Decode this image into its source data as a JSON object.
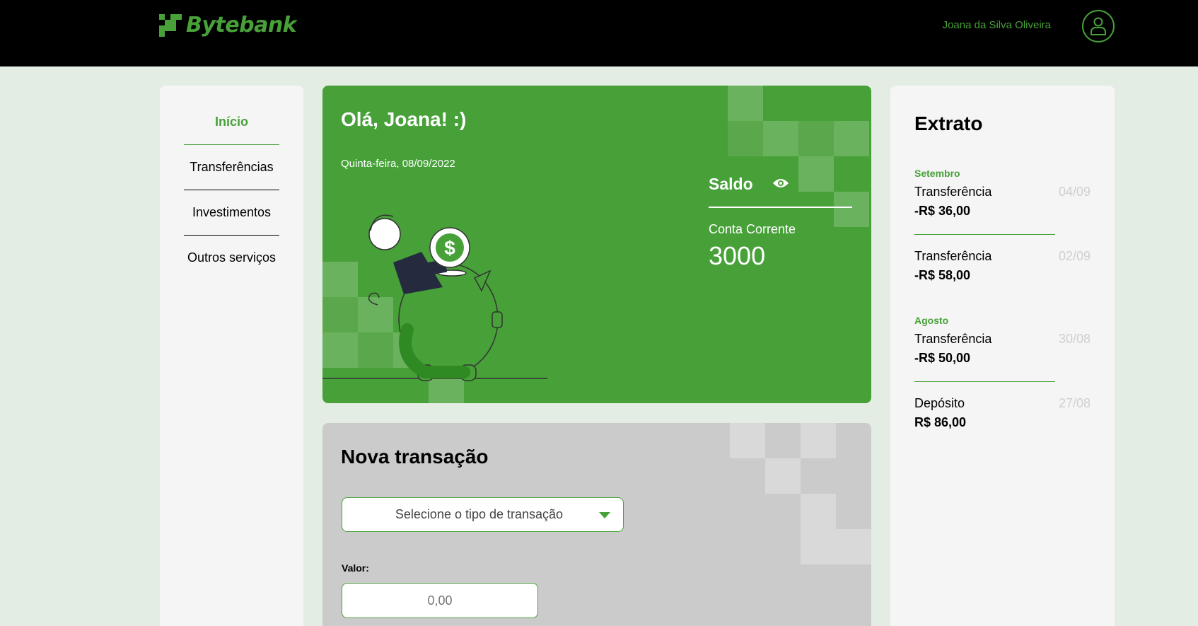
{
  "header": {
    "brand": "Bytebank",
    "user_name": "Joana da Silva Oliveira",
    "logo_icon": "bytebank-logo-icon",
    "avatar_icon": "user-avatar-icon"
  },
  "sidebar": {
    "items": [
      {
        "label": "Início",
        "active": true
      },
      {
        "label": "Transferências",
        "active": false
      },
      {
        "label": "Investimentos",
        "active": false
      },
      {
        "label": "Outros serviços",
        "active": false
      }
    ]
  },
  "balance": {
    "greeting": "Olá, Joana! :)",
    "date": "Quinta-feira, 08/09/2022",
    "saldo_label": "Saldo",
    "account_label": "Conta Corrente",
    "account_value": "3000",
    "eye_icon": "eye-icon"
  },
  "transaction": {
    "title": "Nova transação",
    "select_placeholder": "Selecione o tipo de transação",
    "value_label": "Valor:",
    "value_placeholder": "0,00"
  },
  "statement": {
    "title": "Extrato",
    "months": [
      "Setembro",
      "Agosto"
    ],
    "entries": [
      {
        "type": "Transferência",
        "amount": "-R$ 36,00",
        "date": "04/09"
      },
      {
        "type": "Transferência",
        "amount": "-R$ 58,00",
        "date": "02/09"
      },
      {
        "type": "Transferência",
        "amount": "-R$ 50,00",
        "date": "30/08"
      },
      {
        "type": "Depósito",
        "amount": "R$ 86,00",
        "date": "27/08"
      }
    ]
  },
  "colors": {
    "brand_green": "#47a138",
    "header_bg": "#000000",
    "page_bg": "#e4ede3",
    "card_grey": "#cbcbcb",
    "panel_bg": "#f5f5f5"
  }
}
